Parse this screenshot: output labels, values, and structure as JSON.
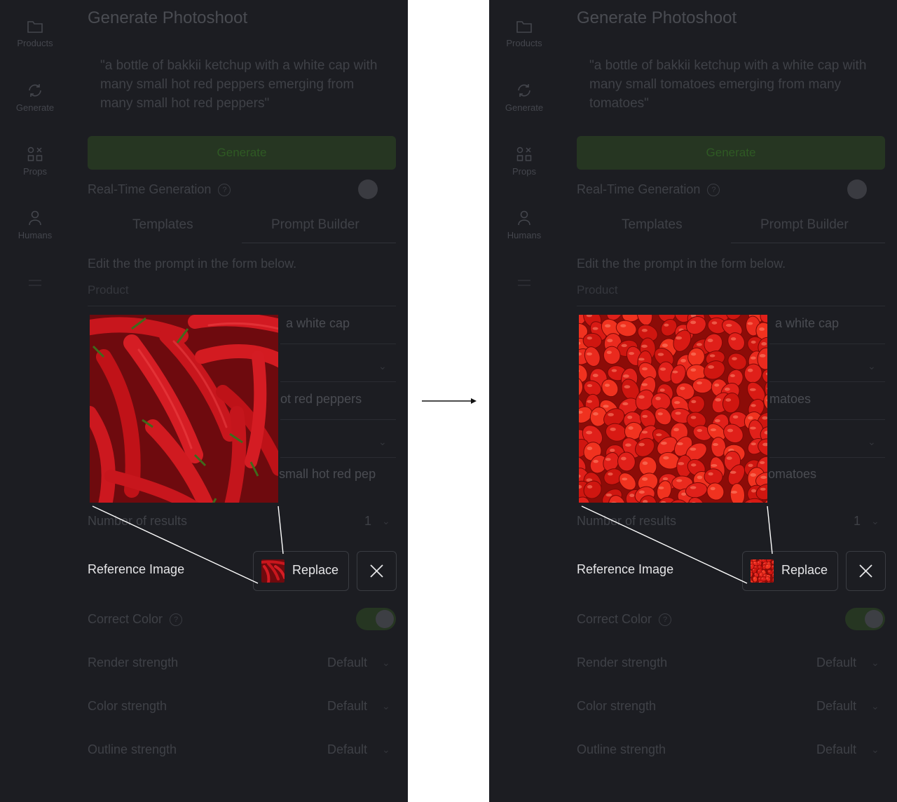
{
  "sidebar": {
    "items": [
      {
        "label": "Products",
        "icon": "folder-icon"
      },
      {
        "label": "Generate",
        "icon": "refresh-icon"
      },
      {
        "label": "Props",
        "icon": "shapes-icon"
      },
      {
        "label": "Humans",
        "icon": "user-icon"
      }
    ]
  },
  "page": {
    "title": "Generate Photoshoot",
    "generate_label": "Generate",
    "realtime_label": "Real-Time Generation",
    "help_glyph": "?",
    "tabs": [
      "Templates",
      "Prompt Builder"
    ],
    "edit_hint": "Edit the the prompt in the form below.",
    "product_label": "Product",
    "results_label": "Number of results",
    "results_value": "1",
    "reference_label": "Reference Image",
    "replace_label": "Replace",
    "correct_color_label": "Correct Color",
    "render_strength_label": "Render strength",
    "color_strength_label": "Color strength",
    "outline_strength_label": "Outline strength",
    "strength_default": "Default"
  },
  "before": {
    "prompt": "\"a bottle of bakkii ketchup with a white cap with many small hot red peppers emerging from many small hot red peppers\"",
    "peek_1": "a white cap",
    "peek_2": "ot red peppers",
    "peek_3": "small hot red pep",
    "reference_subject": "red chili peppers"
  },
  "after": {
    "prompt": "\"a bottle of bakkii ketchup with a white cap with many small tomatoes emerging from many tomatoes\"",
    "peek_1": "a white cap",
    "peek_2": "matoes",
    "peek_3": "omatoes",
    "reference_subject": "cherry tomatoes"
  },
  "colors": {
    "panel_bg": "#1c1d22",
    "generate_green": "#263622",
    "chili_red": "#c8161d",
    "tomato_red": "#e0201a"
  }
}
